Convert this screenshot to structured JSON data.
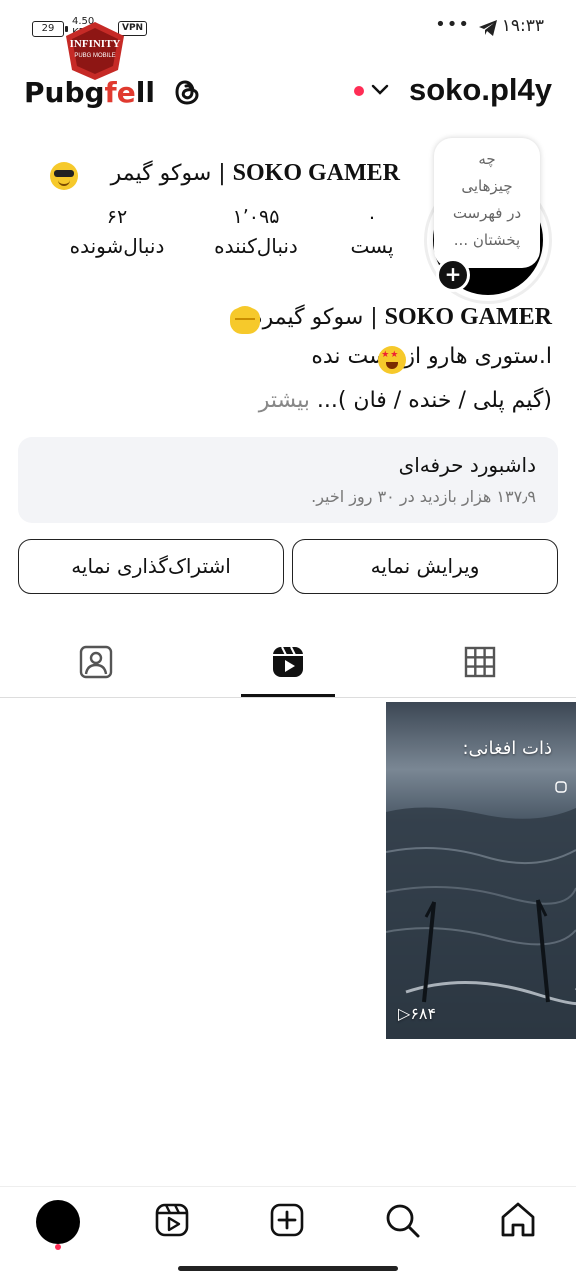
{
  "status_bar": {
    "battery": "29",
    "net_speed": "4.50",
    "net_unit": "KB/s",
    "vpn": "VPN",
    "dots": "•••",
    "time": "۱۹:۳۳"
  },
  "watermark": {
    "brand": "Pubg",
    "brand_red": "fe",
    "brand_end": "ll",
    "badge_title": "INFINITY",
    "badge_sub": "PUBG MOBILE"
  },
  "header": {
    "username": "soko.pl4y"
  },
  "profile": {
    "note": [
      "چه",
      "چیزهایی",
      "در فهرست",
      "پخشتان ..."
    ],
    "display_name_bold": "SOKO GAMER",
    "display_name_rest": " | سوکو گیمر ",
    "stats": [
      {
        "value": "۰",
        "label": "پست"
      },
      {
        "value": "۱٬۰۹۵",
        "label": "دنبال‌کننده"
      },
      {
        "value": "۶۲",
        "label": "دنبال‌شونده"
      }
    ]
  },
  "bio": {
    "line1_bold": "SOKO GAMER",
    "line1_rest": " | سوکو گیمرم ",
    "line2": "ا.ستوری هارو از دست نده",
    "line3": "(گیم پلی / خنده / فان )...",
    "more": " بیشتر"
  },
  "dashboard": {
    "title": "داشبورد حرفه‌ای",
    "subtitle": "۱۳۷٫۹ هزار بازدید در ۳۰ روز اخیر."
  },
  "buttons": {
    "edit": "ویرایش نمایه",
    "share": "اشتراک‌گذاری نمایه"
  },
  "tabs": [
    "grid-icon",
    "reels-icon",
    "tagged-icon"
  ],
  "reels": [
    {
      "caption": "ذات افغانی:",
      "views": "۶۸۴"
    }
  ],
  "bottom_nav": [
    "profile",
    "search",
    "create",
    "reels",
    "home"
  ],
  "colors": {
    "accent_red": "#ff2d55",
    "dashboard_bg": "#f3f4f7"
  }
}
